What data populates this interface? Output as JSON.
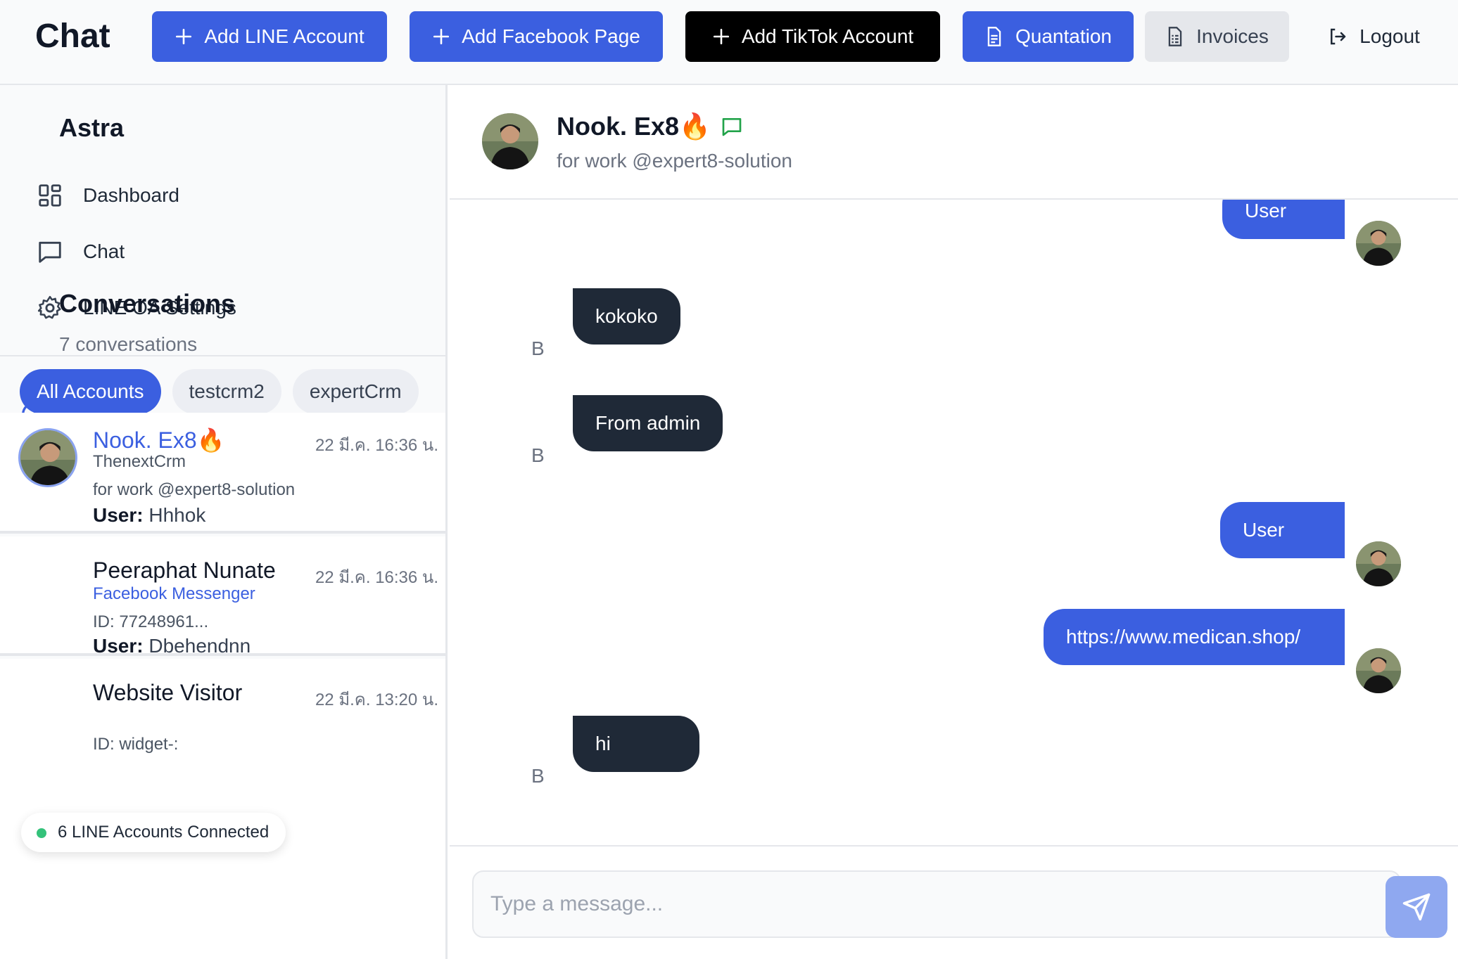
{
  "topbar": {
    "title": "Chat",
    "add_line_label": "Add LINE Account",
    "add_facebook_label": "Add Facebook Page",
    "add_tiktok_label": "Add TikTok Account",
    "quotation_label": "Quantation",
    "invoices_label": "Invoices",
    "logout_label": "Logout"
  },
  "sidebar": {
    "brand": "Astra",
    "nav": [
      {
        "label": "Dashboard",
        "icon": "dashboard-icon"
      },
      {
        "label": "Chat",
        "icon": "chat-icon"
      },
      {
        "label": "LINE OA Settings",
        "icon": "gear-icon"
      }
    ],
    "conversations_title": "Conversations",
    "conversations_count": "7 conversations",
    "filters": [
      "All Accounts",
      "testcrm2",
      "expertCrm"
    ],
    "conversations": [
      {
        "name": "Nook. Ex8🔥",
        "time": "22 มี.ค. 16:36 น.",
        "account": "ThenextCrm",
        "sub": "for work @expert8-solution",
        "last_label": "User:",
        "last_text": "Hhhok"
      },
      {
        "name": "Peeraphat Nunate",
        "time": "22 มี.ค. 16:36 น.",
        "account": "Facebook Messenger",
        "sub": "ID: 77248961...",
        "last_label": "User:",
        "last_text": "Dbehendnn"
      },
      {
        "name": "Website Visitor",
        "time": "22 มี.ค. 13:20 น.",
        "account": "",
        "sub": "ID: widget-:",
        "last_label": "",
        "last_text": ""
      }
    ],
    "status": "6 LINE Accounts Connected"
  },
  "chat": {
    "contact_name": "Nook. Ex8🔥",
    "contact_sub": "for work @expert8-solution",
    "messages": [
      {
        "from": "user",
        "text": "User"
      },
      {
        "from": "admin",
        "text": "kokoko",
        "label": "B"
      },
      {
        "from": "admin",
        "text": "From admin",
        "label": "B"
      },
      {
        "from": "user",
        "text": "User"
      },
      {
        "from": "user",
        "text": "https://www.medican.shop/"
      },
      {
        "from": "admin",
        "text": "hi",
        "label": "B"
      }
    ],
    "input_placeholder": "Type a message..."
  },
  "colors": {
    "accent": "#3b5fe0",
    "admin_bubble": "#1f2937",
    "status_dot": "#34c27a"
  }
}
